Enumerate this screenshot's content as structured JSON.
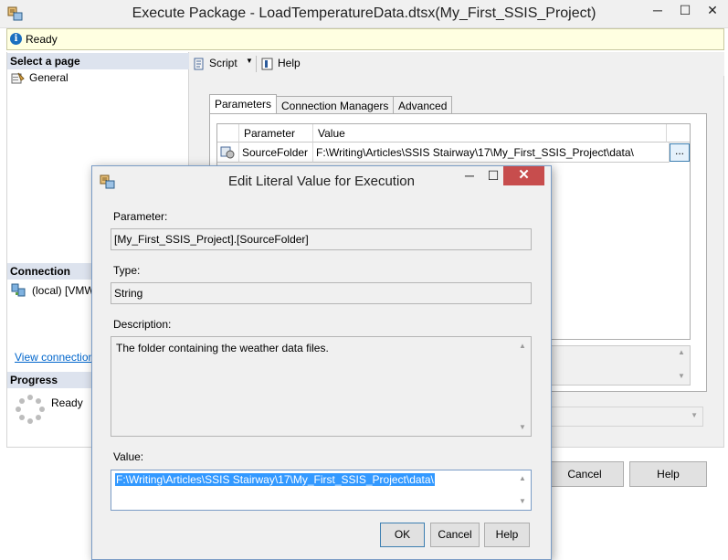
{
  "main_window": {
    "title": "Execute Package - LoadTemperatureData.dtsx(My_First_SSIS_Project)",
    "controls": {
      "minimize": "─",
      "maximize": "☐",
      "close": "✕"
    }
  },
  "status_bar": {
    "text": "Ready"
  },
  "left_pane": {
    "select_page_header": "Select a page",
    "pages": [
      {
        "label": "General"
      }
    ],
    "connection_header": "Connection",
    "connection_server": "(local) [VMW",
    "view_connection_link": "View connection",
    "progress_header": "Progress",
    "progress_status": "Ready"
  },
  "toolbar": {
    "script_label": "Script",
    "help_label": "Help"
  },
  "tabs": [
    {
      "label": "Parameters",
      "active": true
    },
    {
      "label": "Connection Managers",
      "active": false
    },
    {
      "label": "Advanced",
      "active": false
    }
  ],
  "parameters_grid": {
    "columns": [
      "Parameter",
      "Value"
    ],
    "rows": [
      {
        "parameter": "SourceFolder",
        "value": "F:\\Writing\\Articles\\SSIS Stairway\\17\\My_First_SSIS_Project\\data\\",
        "browse_label": "..."
      }
    ]
  },
  "main_buttons": {
    "cancel": "Cancel",
    "help": "Help"
  },
  "dialog": {
    "title": "Edit Literal Value for Execution",
    "parameter_label": "Parameter:",
    "parameter_value": "[My_First_SSIS_Project].[SourceFolder]",
    "type_label": "Type:",
    "type_value": "String",
    "description_label": "Description:",
    "description_value": "The folder containing the weather data files.",
    "value_label": "Value:",
    "value_value": "F:\\Writing\\Articles\\SSIS Stairway\\17\\My_First_SSIS_Project\\data\\",
    "buttons": {
      "ok": "OK",
      "cancel": "Cancel",
      "help": "Help"
    },
    "controls": {
      "minimize": "─",
      "maximize": "☐",
      "close": "✕"
    }
  },
  "colors": {
    "selection": "#3399ff",
    "status_bar_bg": "#ffffe1",
    "pane_header_bg": "#dde3ee",
    "dialog_close_bg": "#c74d4d",
    "link": "#0066cc"
  },
  "icons": [
    "app-icon",
    "info-icon",
    "general-page-icon",
    "server-icon",
    "progress-spinner-icon",
    "script-icon",
    "help-icon",
    "parameter-row-icon"
  ]
}
